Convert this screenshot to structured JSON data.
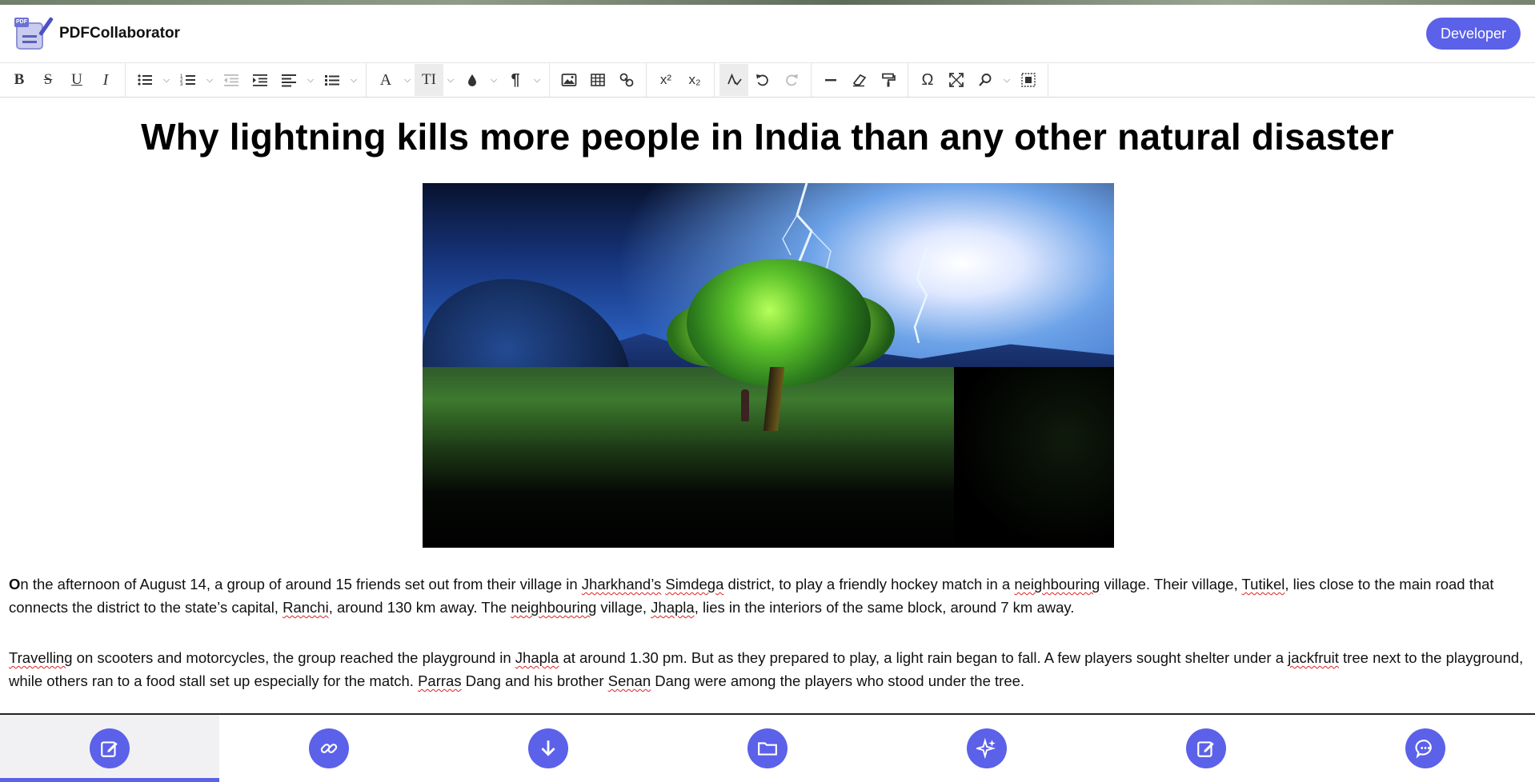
{
  "app": {
    "title": "PDFCollaborator",
    "logo_tag": "PDF",
    "developer_button": "Developer",
    "accent_color": "#5b61e8"
  },
  "toolbar": {
    "groups": [
      [
        "bold-icon",
        "strikethrough-icon",
        "underline-icon",
        "italic-icon"
      ],
      [
        "bulleted-list-icon",
        "numbered-list-icon",
        "outdent-icon",
        "indent-icon",
        "align-icon",
        "line-height-icon"
      ],
      [
        "font-color-icon",
        "font-size-icon",
        "highlight-icon",
        "paragraph-icon"
      ],
      [
        "image-icon",
        "table-icon",
        "link-icon"
      ],
      [
        "superscript-icon",
        "subscript-icon"
      ],
      [
        "spellcheck-icon",
        "undo-icon",
        "redo-icon"
      ],
      [
        "horizontal-line-icon",
        "eraser-icon",
        "format-painter-icon"
      ],
      [
        "special-character-icon",
        "fullscreen-icon",
        "find-icon",
        "select-all-icon"
      ]
    ],
    "labels": {
      "bold": "B",
      "strikethrough": "S",
      "underline": "U",
      "italic": "I",
      "font_color": "A",
      "font_size": "TI",
      "paragraph": "¶",
      "superscript": "x²",
      "subscript": "x₂",
      "special_character": "Ω"
    }
  },
  "article": {
    "headline": "Why lightning kills more people in India than any other natural disaster",
    "p1": {
      "first_letter": "O",
      "t1": "n the afternoon of August 14, a group of around 15 friends set out from their village in ",
      "s1": "Jharkhand’s",
      "t2": " ",
      "s2": "Simdega",
      "t3": " district, to play a friendly hockey match in a ",
      "s3": "neighbouring",
      "t4": " village. Their village, ",
      "s4": "Tutikel",
      "t5": ", lies close to the main road that connects the district to the state’s capital, ",
      "s5": "Ranchi",
      "t6": ", around 130 km away. The ",
      "s6": "neighbouring",
      "t7": " village, ",
      "s7": "Jhapla",
      "t8": ", lies in the interiors of the same block, around 7 km away."
    },
    "p2": {
      "s1": "Travelling",
      "t1": " on scooters and motorcycles, the group reached the playground in ",
      "s2": "Jhapla",
      "t2": " at around 1.30 pm. But as they prepared to play, a light rain began to fall. A few players sought shelter under a ",
      "s3": "jackfruit",
      "t3": " tree next to the playground, while others ran to a food stall set up especially for the match. ",
      "s4": "Parras",
      "t4": " Dang and his brother ",
      "s5": "Senan",
      "t5": " Dang were among the players who stood under the tree."
    }
  },
  "bottom_nav": {
    "items": [
      "edit-icon",
      "link-icon",
      "download-icon",
      "folder-icon",
      "ai-sparkle-icon",
      "edit-note-icon",
      "chat-icon"
    ],
    "active_index": 0
  }
}
